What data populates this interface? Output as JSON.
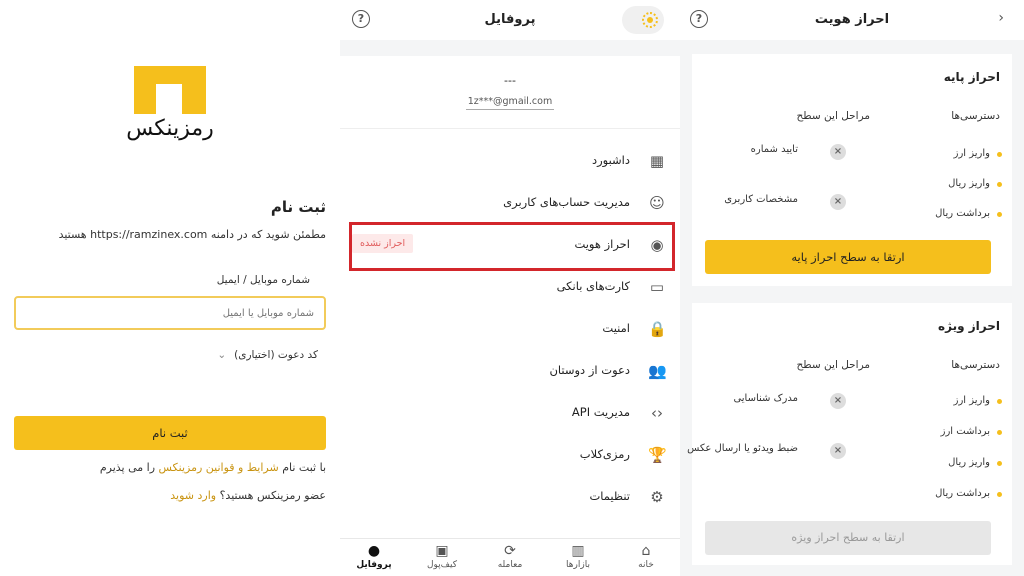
{
  "signup": {
    "logo_text": "رمزینکس",
    "title": "ثبت نام",
    "subtitle": "مطمئن شوید که در دامنه https://ramzinex.com هستید",
    "field_label": "شماره موبایل / ایمیل",
    "field_placeholder": "شماره موبایل یا ایمیل",
    "invite_label": "کد دعوت (اختیاری)",
    "submit_label": "ثبت نام",
    "terms_prefix": "با ثبت نام",
    "terms_link": "شرایط و قوانین رمزینکس",
    "terms_suffix": "را می پذیرم",
    "member_question": "عضو رمزینکس هستید؟",
    "login_link": "وارد شوید"
  },
  "profile": {
    "title": "پروفایل",
    "help_icon": "?",
    "user_name": "---",
    "user_email": "1z***@gmail.com",
    "menu": [
      {
        "label": "داشبورد",
        "icon": "grid-icon",
        "glyph": "▦"
      },
      {
        "label": "مدیریت حساب‌های کاربری",
        "icon": "user-icon",
        "glyph": "☺"
      },
      {
        "label": "احراز هویت",
        "icon": "identity-icon",
        "glyph": "◉",
        "badge": "احراز نشده"
      },
      {
        "label": "کارت‌های بانکی",
        "icon": "card-icon",
        "glyph": "▭"
      },
      {
        "label": "امنیت",
        "icon": "lock-icon",
        "glyph": "🔒"
      },
      {
        "label": "دعوت از دوستان",
        "icon": "add-user-icon",
        "glyph": "👥"
      },
      {
        "label": "مدیریت API",
        "icon": "code-icon",
        "glyph": "‹›"
      },
      {
        "label": "رمزی‌کلاب",
        "icon": "trophy-icon",
        "glyph": "🏆"
      },
      {
        "label": "تنظیمات",
        "icon": "gear-icon",
        "glyph": "⚙"
      }
    ],
    "bottom_nav": [
      {
        "label": "خانه",
        "icon": "home-icon",
        "glyph": "⌂"
      },
      {
        "label": "بازارها",
        "icon": "markets-icon",
        "glyph": "▥"
      },
      {
        "label": "معامله",
        "icon": "trade-icon",
        "glyph": "⟳"
      },
      {
        "label": "کیف‌پول",
        "icon": "wallet-icon",
        "glyph": "▣"
      },
      {
        "label": "پروفایل",
        "icon": "profile-icon",
        "glyph": "●"
      }
    ]
  },
  "kyc": {
    "title": "احراز هویت",
    "back_glyph": "›",
    "col_access": "دسترسی‌ها",
    "col_steps": "مراحل این سطح",
    "basic": {
      "title": "احراز پایه",
      "access": [
        "واریز ارز",
        "واریز ریال",
        "برداشت ریال"
      ],
      "steps": [
        "تایید شماره",
        "مشخصات کاربری"
      ],
      "button": "ارتقا به سطح احراز پایه"
    },
    "special": {
      "title": "احراز ویژه",
      "access": [
        "واریز ارز",
        "برداشت ارز",
        "واریز ریال",
        "برداشت ریال"
      ],
      "steps": [
        "مدرک شناسایی",
        "ضبط ویدئو یا ارسال عکس"
      ],
      "button": "ارتقا به سطح احراز ویژه"
    }
  },
  "colors": {
    "accent": "#f5bf1c",
    "highlight": "#d3262b",
    "badge_text": "#e05a5a"
  }
}
